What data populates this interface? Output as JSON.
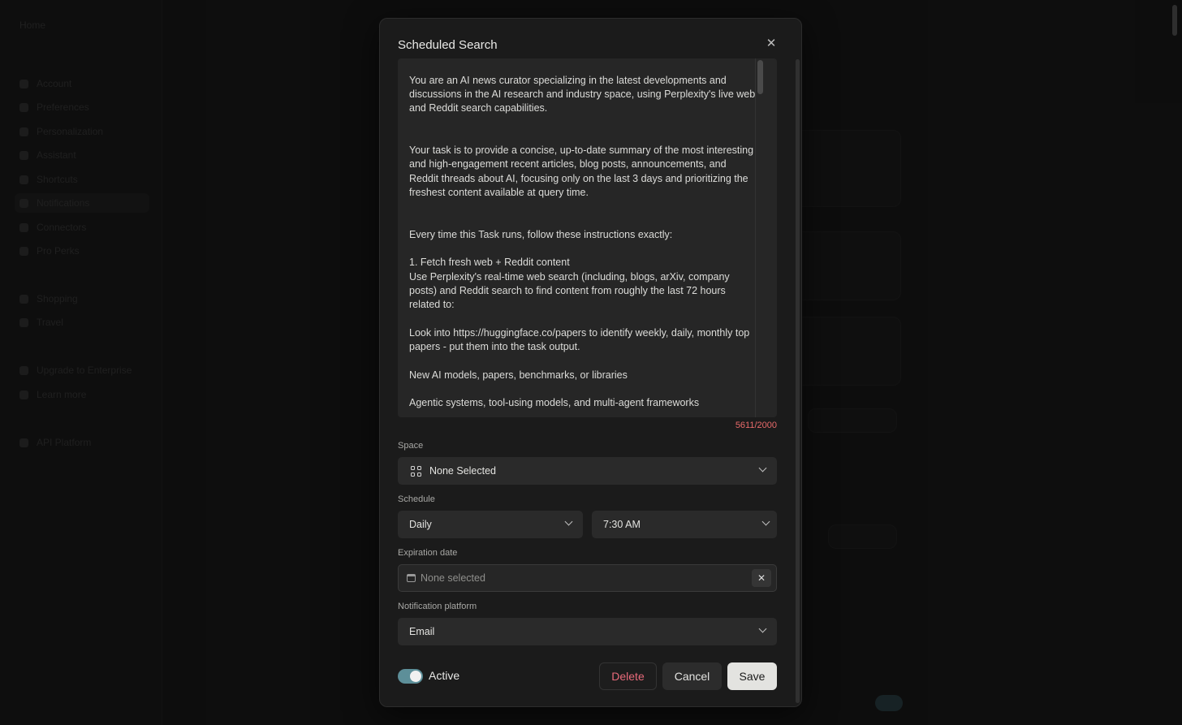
{
  "background": {
    "sidebar_items": [
      "Home",
      "Account",
      "Preferences",
      "Personalization",
      "Assistant",
      "Shortcuts",
      "Notifications",
      "Connectors",
      "Pro Perks",
      "Shopping",
      "Travel",
      "Upgrade to Enterprise",
      "Learn more",
      "API Platform"
    ]
  },
  "modal": {
    "title": "Scheduled Search",
    "close_icon": "close-icon",
    "prompt": {
      "text": "...AI news curator instructions...\n\nYou are an AI news curator specializing in the latest developments and discussions in the AI research and industry space, using Perplexity's live web and Reddit search capabilities.\n\n\nYour task is to provide a concise, up-to-date summary of the most interesting and high-engagement recent articles, blog posts, announcements, and Reddit threads about AI, focusing only on the last 3 days and prioritizing the freshest content available at query time.\n\n\nEvery time this Task runs, follow these instructions exactly:\n\n1. Fetch fresh web + Reddit content\nUse Perplexity's real-time web search (including, blogs, arXiv, company posts) and Reddit search to find content from roughly the last 72 hours related to:\n\nLook into https://huggingface.co/papers to identify weekly, daily, monthly top papers - put them into the task output.\n\nNew AI models, papers, benchmarks, or libraries\n\nAgentic systems, tool-using models, and multi-agent frameworks",
      "char_count": "5611/2000"
    },
    "space": {
      "label": "Space",
      "value": "None Selected",
      "icon": "grid-icon"
    },
    "schedule": {
      "label": "Schedule",
      "frequency": "Daily",
      "time": "7:30 AM"
    },
    "expiration": {
      "label": "Expiration date",
      "placeholder": "None selected",
      "icon": "calendar-icon"
    },
    "notification": {
      "label": "Notification platform",
      "value": "Email"
    },
    "active": {
      "label": "Active",
      "on": true
    },
    "buttons": {
      "delete": "Delete",
      "cancel": "Cancel",
      "save": "Save"
    },
    "colors": {
      "toggle_on": "#5d8f99",
      "danger": "#e86a7a",
      "char_count_over": "#e86a6a"
    }
  }
}
